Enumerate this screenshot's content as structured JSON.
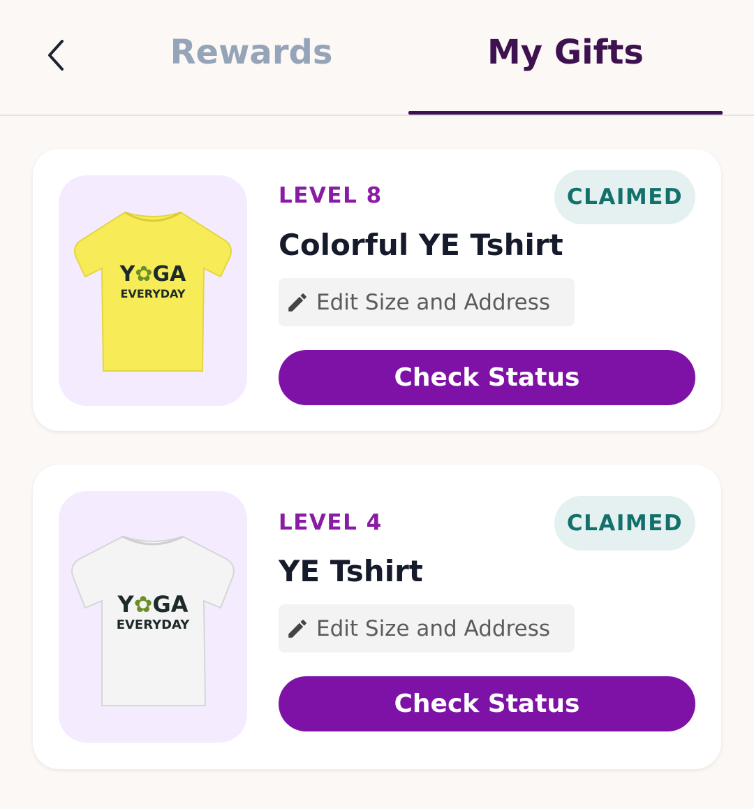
{
  "header": {
    "back_icon": "chevron-left-icon",
    "tabs": [
      {
        "label": "Rewards",
        "active": false
      },
      {
        "label": "My Gifts",
        "active": true
      }
    ]
  },
  "colors": {
    "active_tab": "#3e1150",
    "inactive_tab": "#95a4b8",
    "level_text": "#8a1ba4",
    "badge_bg": "#e4f1f0",
    "badge_text": "#13706b",
    "button_bg": "#7e12a6",
    "thumb_bg": "#f4ebfe"
  },
  "gifts": [
    {
      "level": "LEVEL 8",
      "status": "CLAIMED",
      "title": "Colorful YE Tshirt",
      "edit_label": "Edit Size and Address",
      "edit_icon": "pencil-icon",
      "button_label": "Check Status",
      "image": {
        "shirt_color": "#f7ec58",
        "logo_word": "YOGA",
        "logo_sub": "EVERYDAY"
      }
    },
    {
      "level": "LEVEL 4",
      "status": "CLAIMED",
      "title": "YE Tshirt",
      "edit_label": "Edit Size and Address",
      "edit_icon": "pencil-icon",
      "button_label": "Check Status",
      "image": {
        "shirt_color": "#f4f4f4",
        "logo_word": "YOGA",
        "logo_sub": "EVERYDAY"
      }
    }
  ]
}
